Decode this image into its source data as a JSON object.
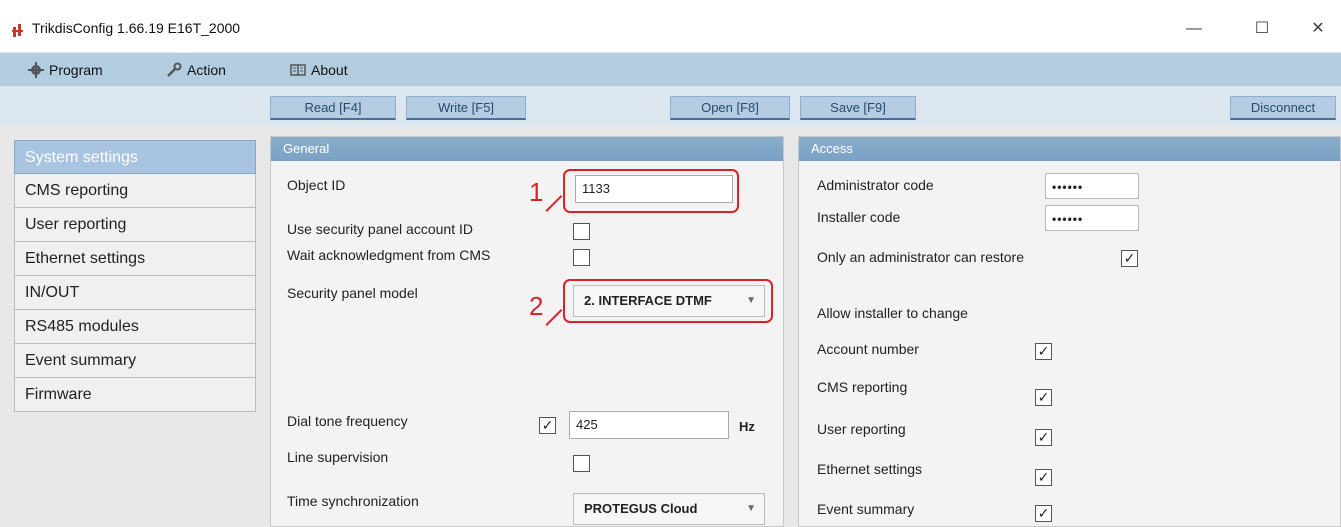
{
  "window": {
    "title": "TrikdisConfig 1.66.19   E16T_2000",
    "minimize": "—",
    "maximize": "☐",
    "close": "✕"
  },
  "menu": {
    "program": "Program",
    "action": "Action",
    "about": "About"
  },
  "toolbar": {
    "read": "Read [F4]",
    "write": "Write [F5]",
    "open": "Open [F8]",
    "save": "Save [F9]",
    "disconnect": "Disconnect"
  },
  "sidebar": {
    "items": [
      {
        "label": "System settings",
        "active": true
      },
      {
        "label": "CMS reporting"
      },
      {
        "label": "User reporting"
      },
      {
        "label": "Ethernet settings"
      },
      {
        "label": "IN/OUT"
      },
      {
        "label": "RS485 modules"
      },
      {
        "label": "Event summary"
      },
      {
        "label": "Firmware"
      }
    ]
  },
  "general": {
    "title": "General",
    "object_id_label": "Object ID",
    "object_id_value": "1133",
    "use_panel_account_label": "Use security panel account ID",
    "use_panel_account_checked": false,
    "wait_ack_label": "Wait acknowledgment from CMS",
    "wait_ack_checked": false,
    "panel_model_label": "Security panel model",
    "panel_model_value": "2. INTERFACE DTMF",
    "dial_tone_label": "Dial tone frequency",
    "dial_tone_checked": true,
    "dial_tone_value": "425",
    "dial_tone_unit": "Hz",
    "line_supervision_label": "Line supervision",
    "line_supervision_checked": false,
    "time_sync_label": "Time synchronization",
    "time_sync_value": "PROTEGUS Cloud",
    "marker_1": "1",
    "marker_2": "2"
  },
  "access": {
    "title": "Access",
    "admin_code_label": "Administrator code",
    "admin_code_value": "••••••",
    "installer_code_label": "Installer code",
    "installer_code_value": "••••••",
    "only_admin_restore_label": "Only an administrator can restore",
    "only_admin_restore_checked": true,
    "allow_installer_label": "Allow installer to change",
    "account_number_label": "Account number",
    "cms_reporting_label": "CMS reporting",
    "user_reporting_label": "User reporting",
    "ethernet_settings_label": "Ethernet settings",
    "event_summary_label": "Event summary",
    "checkmark": "✓"
  },
  "colors": {
    "accent": "#b3cde0",
    "panel_header": "#7aa1c4",
    "active_item": "#a8c4e0",
    "highlight": "#d9232a"
  }
}
